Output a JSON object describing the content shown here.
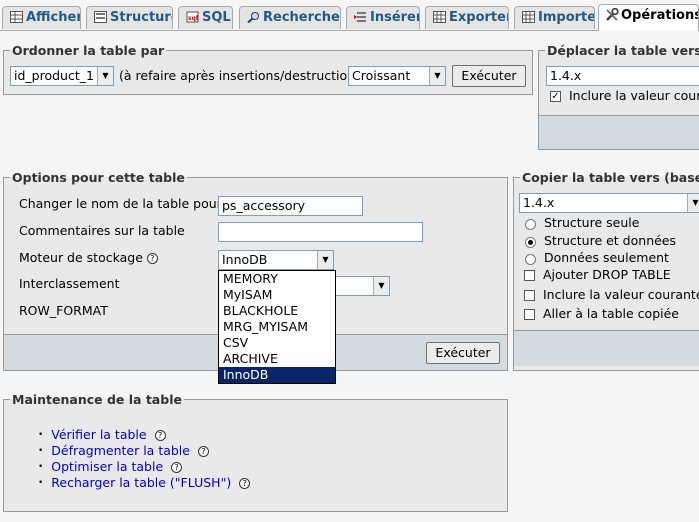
{
  "tabs": [
    {
      "label": "Afficher",
      "icon": "browse-icon"
    },
    {
      "label": "Structure",
      "icon": "structure-icon"
    },
    {
      "label": "SQL",
      "icon": "sql-icon"
    },
    {
      "label": "Rechercher",
      "icon": "search-icon"
    },
    {
      "label": "Insérer",
      "icon": "insert-icon"
    },
    {
      "label": "Exporter",
      "icon": "export-icon"
    },
    {
      "label": "Importer",
      "icon": "import-icon"
    },
    {
      "label": "Opérations",
      "icon": "operations-icon",
      "active": true
    }
  ],
  "order": {
    "legend": "Ordonner la table par",
    "column_value": "id_product_1",
    "note": "(à refaire après insertions/destructions)",
    "direction_value": "Croissant",
    "execute_label": "Exécuter"
  },
  "move": {
    "legend": "Déplacer la table vers (ba",
    "db_value": "1.4.x",
    "include_autoinc_label": "Inclure la valeur couran",
    "include_autoinc_checked": true
  },
  "options": {
    "legend": "Options pour cette table",
    "rename_label": "Changer le nom de la table pour",
    "rename_value": "ps_accessory",
    "comment_label": "Commentaires sur la table",
    "comment_value": "",
    "engine_label": "Moteur de stockage",
    "engine_value": "InnoDB",
    "collation_label": "Interclassement",
    "row_format_label": "ROW_FORMAT",
    "engine_options": [
      "MEMORY",
      "MyISAM",
      "BLACKHOLE",
      "MRG_MYISAM",
      "CSV",
      "ARCHIVE",
      "InnoDB"
    ],
    "engine_selected_index": 6,
    "execute_label": "Exécuter"
  },
  "copy": {
    "legend": "Copier la table vers (base.ta",
    "db_value": "1.4.x",
    "radio_structure_only": "Structure seule",
    "radio_structure_data": "Structure et données",
    "radio_data_only": "Données seulement",
    "selected_radio": "Structure et données",
    "add_drop_label": "Ajouter DROP TABLE",
    "include_autoinc_label": "Inclure la valeur courante de",
    "goto_copied_label": "Aller à la table copiée"
  },
  "maintenance": {
    "legend": "Maintenance de la table",
    "links": [
      "Vérifier la table",
      "Défragmenter la table",
      "Optimiser la table",
      "Recharger la table (\"FLUSH\")"
    ]
  }
}
